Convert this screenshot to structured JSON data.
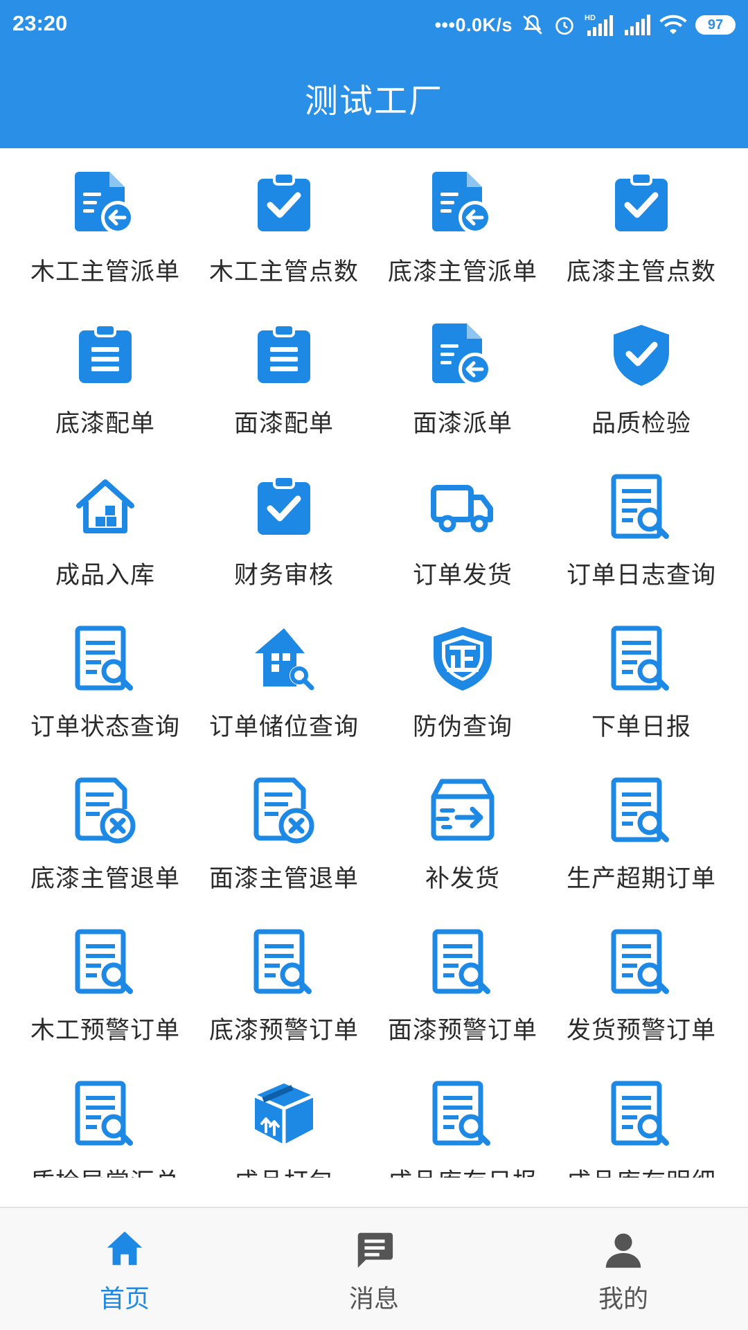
{
  "status_bar": {
    "time": "23:20",
    "net_speed": "0.0K/s",
    "battery": "97"
  },
  "header": {
    "title": "测试工厂"
  },
  "colors": {
    "primary": "#2a8fe6",
    "icon": "#1e88e5",
    "tab_inactive": "#555555"
  },
  "grid_items": [
    {
      "label": "木工主管派单",
      "icon": "document-arrow-icon"
    },
    {
      "label": "木工主管点数",
      "icon": "clipboard-check-icon"
    },
    {
      "label": "底漆主管派单",
      "icon": "document-arrow-icon"
    },
    {
      "label": "底漆主管点数",
      "icon": "clipboard-check-icon"
    },
    {
      "label": "底漆配单",
      "icon": "clipboard-list-icon"
    },
    {
      "label": "面漆配单",
      "icon": "clipboard-list-icon"
    },
    {
      "label": "面漆派单",
      "icon": "document-arrow-icon"
    },
    {
      "label": "品质检验",
      "icon": "shield-check-icon"
    },
    {
      "label": "成品入库",
      "icon": "warehouse-icon"
    },
    {
      "label": "财务审核",
      "icon": "clipboard-check-icon"
    },
    {
      "label": "订单发货",
      "icon": "truck-icon"
    },
    {
      "label": "订单日志查询",
      "icon": "document-search-icon"
    },
    {
      "label": "订单状态查询",
      "icon": "document-search-icon"
    },
    {
      "label": "订单储位查询",
      "icon": "house-search-icon"
    },
    {
      "label": "防伪查询",
      "icon": "shield-zheng-icon"
    },
    {
      "label": "下单日报",
      "icon": "document-search-icon"
    },
    {
      "label": "底漆主管退单",
      "icon": "document-cancel-icon"
    },
    {
      "label": "面漆主管退单",
      "icon": "document-cancel-icon"
    },
    {
      "label": "补发货",
      "icon": "box-arrow-icon"
    },
    {
      "label": "生产超期订单",
      "icon": "document-search-icon"
    },
    {
      "label": "木工预警订单",
      "icon": "document-search-icon"
    },
    {
      "label": "底漆预警订单",
      "icon": "document-search-icon"
    },
    {
      "label": "面漆预警订单",
      "icon": "document-search-icon"
    },
    {
      "label": "发货预警订单",
      "icon": "document-search-icon"
    },
    {
      "label": "质检异常汇总",
      "icon": "document-search-icon"
    },
    {
      "label": "成品打包",
      "icon": "package-icon"
    },
    {
      "label": "成品库存日报",
      "icon": "document-search-icon"
    },
    {
      "label": "成品库存明细",
      "icon": "document-search-icon"
    }
  ],
  "tabs": [
    {
      "label": "首页",
      "icon": "home-icon",
      "active": true
    },
    {
      "label": "消息",
      "icon": "message-icon",
      "active": false
    },
    {
      "label": "我的",
      "icon": "person-icon",
      "active": false
    }
  ]
}
